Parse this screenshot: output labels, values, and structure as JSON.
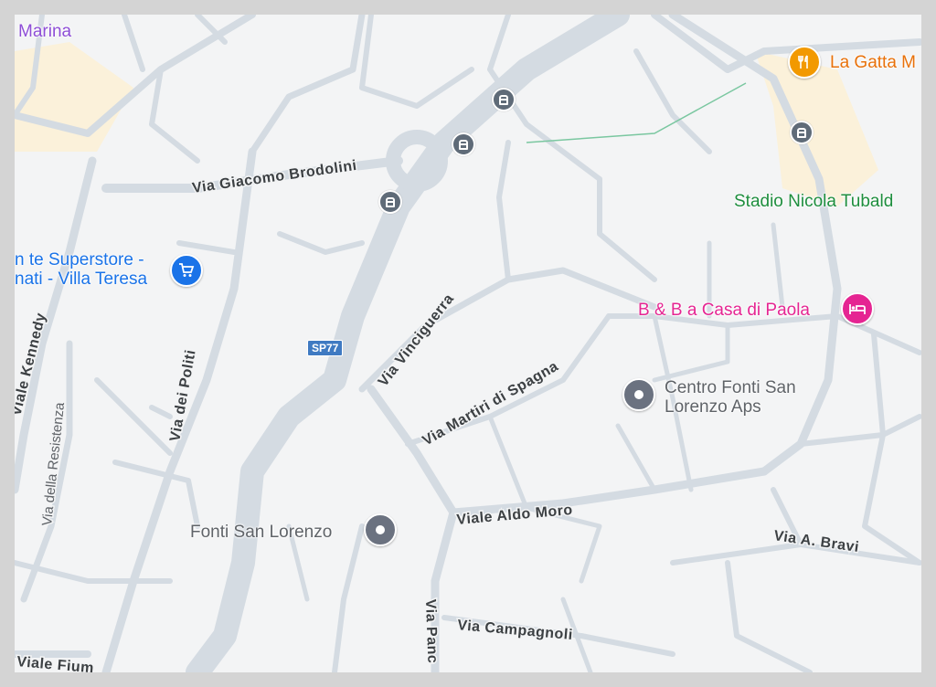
{
  "map": {
    "background": "#f3f4f5",
    "road_color": "#d4dbe2",
    "park_color": "#fbf1da"
  },
  "streets": {
    "via_giacomo_brodolini": "Via Giacomo Brodolini",
    "via_vinciguerra": "Via Vinciguerra",
    "via_martiri_di_spagna": "Via Martiri di Spagna",
    "viale_aldo_moro": "Viale Aldo Moro",
    "via_dei_politi": "Via dei Politi",
    "via_della_resistenza": "Via della Resistenza",
    "viale_kennedy": "Viale Kennedy",
    "via_a_bravi": "Via A. Bravi",
    "via_campagnoli": "Via Campagnoli",
    "via_panc": "Via Panc",
    "viale_fium": "Viale Fium"
  },
  "route_shield": "SP77",
  "pois": {
    "marina": {
      "label": "Marina",
      "color": "#8e4ed6"
    },
    "la_gatta": {
      "label": "La Gatta M",
      "color": "#e8710a",
      "icon": "restaurant-icon"
    },
    "stadio": {
      "label": "Stadio Nicola Tubald",
      "color": "#1e8e3e"
    },
    "superstore": {
      "label_line1": "n te Superstore -",
      "label_line2": "nati - Villa Teresa",
      "color": "#1a73e8",
      "icon": "shopping-cart-icon"
    },
    "bnb": {
      "label": "B & B a Casa di Paola",
      "color": "#e52592",
      "icon": "bed-icon"
    },
    "centro_fonti": {
      "label_line1": "Centro Fonti San",
      "label_line2": "Lorenzo Aps",
      "color": "#5f6368",
      "icon": "place-icon"
    },
    "fonti_san_lorenzo": {
      "label": "Fonti San Lorenzo",
      "color": "#5f6368",
      "icon": "place-icon"
    }
  },
  "bus_stops": [
    "bus-stop-icon",
    "bus-stop-icon",
    "bus-stop-icon",
    "bus-stop-icon"
  ]
}
